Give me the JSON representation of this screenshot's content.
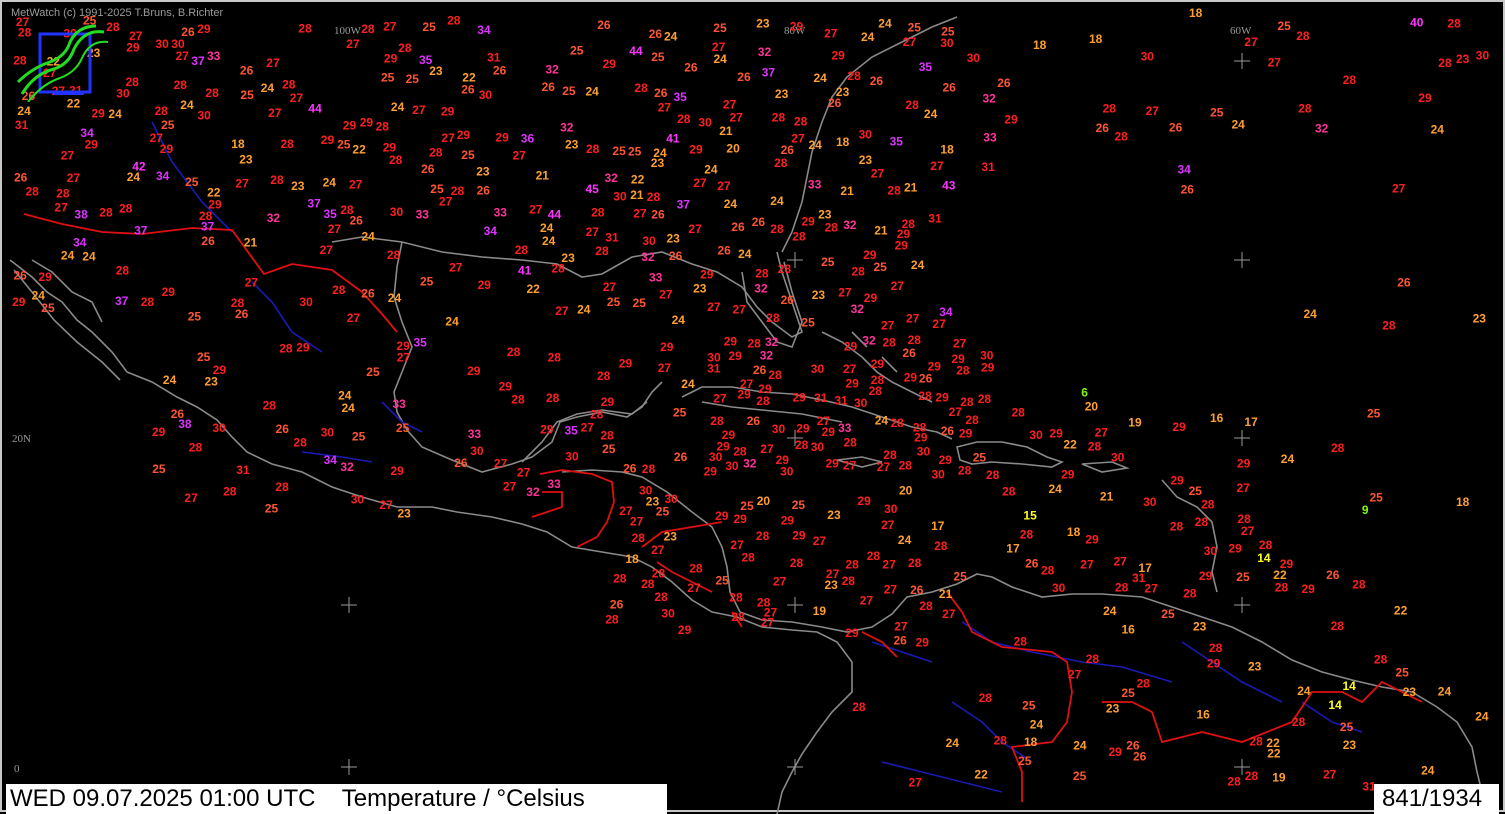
{
  "credit": "MetWatch  (c) 1991-2025 T.Bruns, B.Richter",
  "footer": {
    "datetime": "WED 09.07.2025 01:00 UTC",
    "parameter": "Temperature / °Celsius",
    "counter": "841/1934"
  },
  "grid_labels": [
    {
      "text": "100W"
    },
    {
      "text": "80W"
    },
    {
      "text": "60W"
    },
    {
      "text": "20N"
    },
    {
      "text": "0"
    }
  ],
  "colors": {
    "frame": "#c8c8c8",
    "coastline": "#8a8a8a",
    "rivers": "#1a1ab4",
    "borders": "#e01010",
    "temp_scale": [
      {
        "min": -99,
        "max": 10,
        "color": "#7CFC00"
      },
      {
        "min": 11,
        "max": 15,
        "color": "#ffff20"
      },
      {
        "min": 16,
        "max": 24,
        "color": "#ffa030"
      },
      {
        "min": 25,
        "max": 26,
        "color": "#ff5533"
      },
      {
        "min": 27,
        "max": 31,
        "color": "#ff1f1f"
      },
      {
        "min": 32,
        "max": 33,
        "color": "#ff3399"
      },
      {
        "min": 34,
        "max": 38,
        "color": "#dd33ff"
      },
      {
        "min": 39,
        "max": 99,
        "color": "#ff33ff"
      }
    ]
  },
  "logo": {
    "icon": "metwatch-logo-icon"
  },
  "station_values": [
    29,
    28,
    27,
    27,
    27,
    26,
    23,
    24,
    24,
    23,
    25,
    24,
    21,
    30,
    29,
    29,
    28,
    28,
    27,
    28,
    23,
    22,
    21,
    25,
    24,
    25,
    26,
    24,
    22,
    24,
    24,
    23,
    23,
    32,
    34,
    35,
    35,
    32,
    29,
    32,
    28,
    29,
    30,
    26,
    29,
    27,
    28,
    27,
    27,
    26,
    25,
    24,
    26,
    23,
    26,
    25,
    24,
    25,
    24,
    24,
    22,
    24,
    23,
    34,
    37,
    37,
    34,
    20,
    21,
    18,
    18,
    21,
    28,
    30,
    29,
    30,
    27,
    27,
    26,
    26,
    27,
    22,
    23,
    22,
    21,
    25,
    23,
    26,
    25,
    24,
    26,
    25,
    24,
    22,
    23,
    24,
    37,
    37,
    23,
    18,
    32,
    29,
    31,
    28,
    31,
    29,
    30,
    32,
    30,
    27,
    28,
    28,
    24,
    25,
    24,
    21,
    25,
    23,
    24,
    27,
    25,
    26,
    27,
    27,
    28,
    28,
    32,
    31,
    27,
    26,
    24,
    25,
    25,
    28,
    27,
    29,
    30,
    28,
    27,
    27,
    28,
    29,
    27,
    26,
    24,
    24,
    21,
    23,
    25,
    27,
    28,
    26,
    27,
    26,
    25,
    24,
    26,
    27,
    28,
    29,
    28,
    26,
    30,
    28,
    27,
    41,
    37,
    37,
    34,
    36,
    29,
    28,
    27,
    26,
    27,
    27,
    24,
    23,
    25,
    27,
    26,
    27,
    28,
    29,
    28,
    29,
    28,
    27,
    28,
    29,
    28,
    28,
    27,
    28,
    27,
    28,
    29,
    30,
    26,
    27,
    45,
    37,
    44,
    32,
    33,
    35,
    28,
    29,
    29,
    28,
    27,
    28,
    25,
    25,
    24,
    23,
    27,
    26,
    28,
    27,
    28,
    27,
    26,
    24,
    26,
    25,
    24,
    27,
    28,
    28,
    29,
    28,
    44,
    34,
    33,
    32,
    31,
    30,
    29,
    30,
    28,
    27,
    28,
    29,
    27,
    26,
    27,
    28,
    28,
    28,
    27,
    28,
    26,
    27,
    29,
    25,
    24,
    25,
    44,
    43,
    42,
    41,
    38,
    35,
    29,
    32,
    33,
    28,
    29,
    27,
    26,
    25,
    24,
    23,
    22,
    24,
    27,
    26,
    28,
    25,
    24,
    24,
    28,
    27,
    29,
    25,
    27,
    28,
    26,
    34,
    35,
    33,
    30,
    27,
    33,
    31,
    29,
    28,
    27,
    28,
    26,
    25,
    28,
    27,
    30,
    28,
    28,
    29,
    27,
    26,
    25,
    24,
    28,
    28,
    40,
    33,
    30,
    30,
    32,
    32,
    34,
    31,
    29,
    30,
    28,
    28,
    29,
    28,
    28,
    25,
    24,
    26,
    27,
    26,
    27,
    28,
    27,
    27,
    26,
    29,
    29,
    28,
    28,
    27,
    28,
    29,
    33,
    30,
    29,
    28,
    25,
    30,
    29,
    29,
    25,
    27,
    30,
    28,
    27,
    29,
    27,
    29,
    26,
    28,
    28,
    25,
    25,
    24,
    23,
    30,
    26,
    25,
    23,
    27,
    28,
    29,
    28,
    30,
    28,
    29,
    38,
    32,
    35,
    30,
    35,
    33,
    34,
    33,
    32,
    31,
    30,
    29,
    28,
    27,
    26,
    28,
    27,
    28,
    25,
    24,
    25,
    26,
    25,
    27,
    26,
    25,
    24,
    24,
    28,
    29,
    29,
    29,
    28,
    28,
    32,
    27,
    30,
    32,
    29,
    29,
    31,
    28,
    30,
    26,
    29,
    29,
    27,
    29,
    27,
    28,
    30,
    28,
    29,
    30,
    24,
    29,
    28,
    29,
    28,
    30,
    29,
    26,
    30,
    27,
    26,
    28,
    28,
    27,
    28,
    26,
    29,
    29,
    28,
    28,
    25,
    26,
    28,
    30,
    27,
    31,
    29,
    29,
    28,
    28,
    27,
    28,
    28,
    28,
    28,
    27,
    28,
    27,
    31,
    30,
    30,
    30,
    29,
    28,
    29,
    29,
    32,
    33,
    32,
    29,
    28,
    30,
    29,
    29,
    29,
    29,
    27,
    29,
    28,
    26,
    28,
    27,
    28,
    29,
    28,
    28,
    28,
    28,
    27,
    28,
    27,
    17,
    21,
    20,
    16,
    17,
    22,
    24,
    24,
    25,
    22,
    17,
    15,
    6,
    18,
    19,
    14,
    29,
    30,
    30,
    28,
    29,
    30,
    29,
    28,
    28,
    30,
    28,
    30,
    29,
    29,
    27,
    29,
    28,
    27,
    28,
    27,
    19,
    29,
    29,
    27,
    28,
    23,
    27,
    23,
    27,
    23,
    27,
    28,
    29,
    30,
    27,
    27,
    25,
    27,
    28,
    28,
    28,
    27,
    28,
    27,
    26,
    28,
    23,
    21,
    29,
    30,
    24,
    28,
    18,
    17,
    20,
    20,
    28,
    29,
    28,
    28,
    27,
    27,
    28,
    28,
    28,
    27,
    28,
    26,
    28,
    27,
    28,
    27,
    28,
    25,
    25,
    29,
    29,
    27,
    28,
    29,
    28,
    24,
    27,
    28,
    25,
    28,
    29,
    28,
    28,
    28,
    28,
    28,
    31,
    31,
    29,
    28,
    26,
    26,
    27,
    28,
    28,
    25,
    25,
    22,
    23,
    28,
    24,
    25,
    25,
    27,
    16,
    14,
    23,
    24,
    23,
    16,
    25,
    25,
    24,
    29,
    23,
    26,
    24,
    23,
    22,
    18,
    19,
    22,
    28,
    25,
    25,
    24,
    26,
    23,
    18,
    28,
    26,
    22,
    24,
    25,
    14,
    9,
    24,
    24,
    25,
    28
  ],
  "reference_labels": [
    {
      "text": "18"
    },
    {
      "text": "18"
    },
    {
      "text": "18"
    },
    {
      "text": "23"
    }
  ]
}
